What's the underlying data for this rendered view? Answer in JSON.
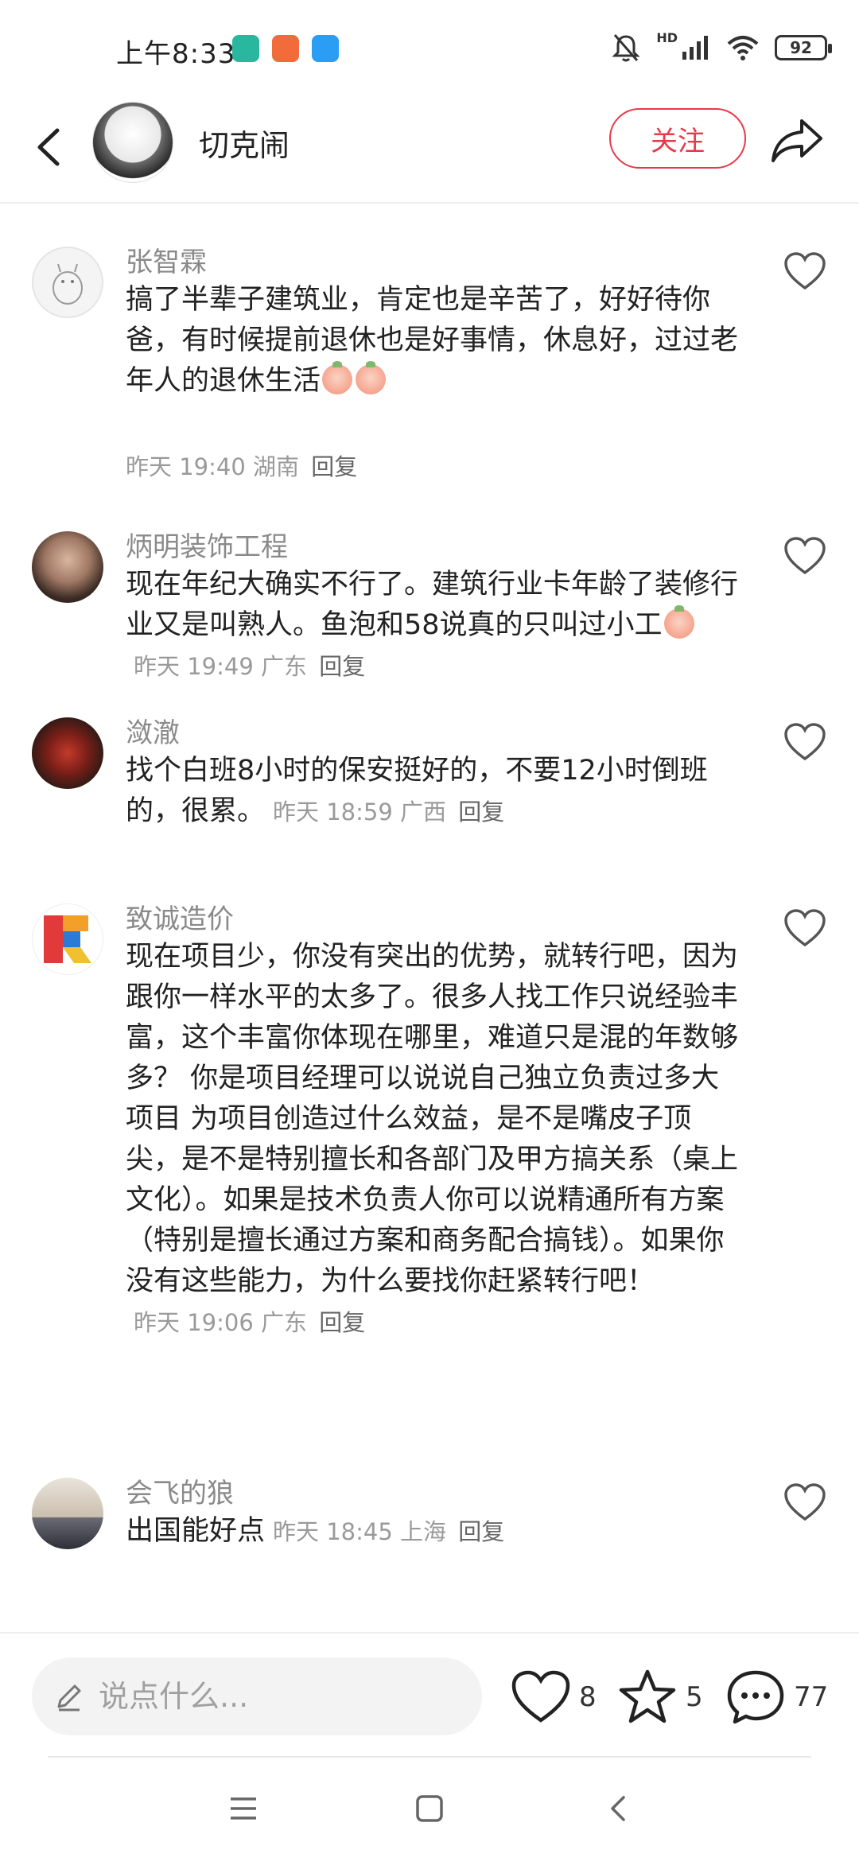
{
  "status_bar": {
    "time": "上午8:33",
    "battery": "92",
    "network": "HD"
  },
  "header": {
    "title": "切克闹",
    "follow_label": "关注"
  },
  "comments": [
    {
      "name": "张智霖",
      "text": "搞了半辈子建筑业，肯定也是辛苦了，好好待你爸，有时候提前退休也是好事情，休息好，过过老年人的退休生活",
      "emoji_count": 2,
      "time": "昨天 19:40",
      "location": "湖南",
      "reply": "回复"
    },
    {
      "name": "炳明装饰工程",
      "text": "现在年纪大确实不行了。建筑行业卡年龄了装修行业又是叫熟人。鱼泡和58说真的只叫过小工",
      "emoji_count": 1,
      "time": "昨天 19:49",
      "location": "广东",
      "reply": "回复"
    },
    {
      "name": "潋澈",
      "text": "找个白班8小时的保安挺好的，不要12小时倒班的，很累。",
      "time": "昨天 18:59",
      "location": "广西",
      "reply": "回复"
    },
    {
      "name": "致诚造价",
      "text": "现在项目少，你没有突出的优势，就转行吧，因为跟你一样水平的太多了。很多人找工作只说经验丰富，这个丰富你体现在哪里，难道只是混的年数够多？   你是项目经理可以说说自己独立负责过多大项目  为项目创造过什么效益，是不是嘴皮子顶尖，是不是特别擅长和各部门及甲方搞关系（桌上文化）。如果是技术负责人你可以说精通所有方案（特别是擅长通过方案和商务配合搞钱）。如果你没有这些能力，为什么要找你赶紧转行吧！",
      "time": "昨天 19:06",
      "location": "广东",
      "reply": "回复"
    },
    {
      "name": "会飞的狼",
      "text": "出国能好点",
      "time": "昨天 18:45",
      "location": "上海",
      "reply": "回复"
    }
  ],
  "bottom_bar": {
    "input_placeholder": "说点什么...",
    "like_count": "8",
    "star_count": "5",
    "comment_count": "77"
  },
  "colors": {
    "accent": "#e7394a",
    "meta_text": "#9a9a9a",
    "name_text": "#8a8a8a"
  },
  "icons": [
    "back-icon",
    "share-icon",
    "heart-icon",
    "star-icon",
    "comment-icon",
    "pencil-icon",
    "menu-icon",
    "home-icon",
    "nav-back-icon"
  ]
}
